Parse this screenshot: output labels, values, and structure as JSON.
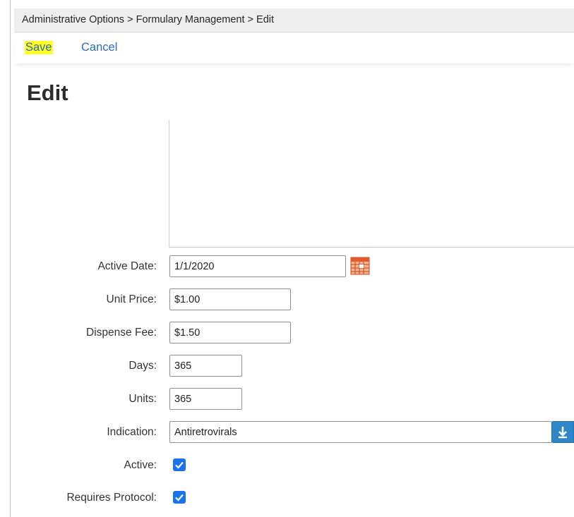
{
  "breadcrumb": "Administrative Options > Formulary Management > Edit",
  "actions": {
    "save_label": "Save",
    "cancel_label": "Cancel"
  },
  "page_title": "Edit",
  "form": {
    "active_date": {
      "label": "Active Date:",
      "value": "1/1/2020"
    },
    "unit_price": {
      "label": "Unit Price:",
      "value": "$1.00"
    },
    "dispense_fee": {
      "label": "Dispense Fee:",
      "value": "$1.50"
    },
    "days": {
      "label": "Days:",
      "value": "365"
    },
    "units": {
      "label": "Units:",
      "value": "365"
    },
    "indication": {
      "label": "Indication:",
      "value": "Antiretrovirals"
    },
    "active": {
      "label": "Active:",
      "checked": true
    },
    "requires_protocol": {
      "label": "Requires Protocol:",
      "checked": true
    }
  },
  "icons": {
    "calendar": "calendar-icon",
    "dropdown": "download-arrow-icon",
    "checkmark": "checkmark-icon"
  },
  "colors": {
    "link": "#2a6db3",
    "save_highlight": "#ffff24",
    "checkbox": "#1a73e8",
    "dropdown_button": "#2f86c9",
    "calendar_accent": "#e05a2b"
  }
}
